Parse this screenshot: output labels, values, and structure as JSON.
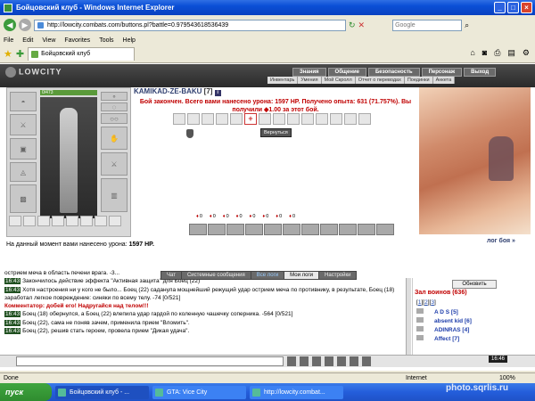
{
  "window": {
    "title": "Бойцовский клуб - Windows Internet Explorer"
  },
  "address": {
    "url": "http://lowcity.combats.com/buttons.pl?battle=0.979543618536439",
    "search_placeholder": "Google"
  },
  "menu": [
    "File",
    "Edit",
    "View",
    "Favorites",
    "Tools",
    "Help"
  ],
  "tab": {
    "label": "Бойцовский клуб"
  },
  "game": {
    "logo": "LOWCITY",
    "topnav": [
      "Знания",
      "Общение",
      "Безопасность",
      "Персонаж",
      "Выход"
    ],
    "subnav": [
      "Инвентарь",
      "Умения",
      "Мой Скролл",
      "Отчет о переводах",
      "Поединки",
      "Анкета"
    ],
    "hp": "0/473",
    "nick": "KAMIKAD-ZE-BAKU",
    "level": "[7]",
    "end_msg": "Бой закончен. Всего вами нанесено урона: 1597 HP. Получено опыта: 631 (71.757%). Вы получили ◆1.00 за этот бой.",
    "back_button": "Вернуться",
    "stats": [
      "0",
      "0",
      "0",
      "0",
      "0",
      "0",
      "0",
      "0"
    ],
    "damage_prefix": "На данный момент вами нанесено урона:",
    "damage_value": "1597 HP.",
    "log_link": "лог боя »"
  },
  "chat": {
    "tabs": [
      "Чат",
      "Системные сообщения",
      "Все логи",
      "Мои логи",
      "Настройки"
    ],
    "lines": [
      {
        "pre": "",
        "text": "острием меча в область печени врага. -3..."
      },
      {
        "time": "16:43",
        "text": "Закончилось действие эффекта \"Активная защита\" для Боец (22)"
      },
      {
        "time": "16:43",
        "text": "Хотя настроения ни у кого не было... Боец (22) саданула мощнейший режущий удар острием меча по противнику, в результате, Боец (18) заработал легкое повреждение: синяки по всему телу. -74 [0/521]"
      },
      {
        "pre": "Комментатор:",
        "text": "добей его! Надругайся над телом!!!"
      },
      {
        "time": "16:43",
        "text": "Боец (18) обернулся, а Боец (22) влепила удар гардой по коленную чашечку соперника. -564 [0/521]"
      },
      {
        "time": "16:43",
        "text": "Боец (22), сама не поняв зачем, применила прием \"Вломить\"."
      },
      {
        "time": "16:43",
        "text": "Боец (22), решив стать героем, провела прием \"Дикая удача\"."
      }
    ]
  },
  "room": {
    "refresh": "Обновить",
    "title": "Зал воинов (636)",
    "pages": [
      "1",
      "2",
      "3"
    ],
    "players": [
      "A D S [5]",
      "absent kid [6]",
      "ADINRAS [4]",
      "Affect [7]"
    ]
  },
  "clock": "16:46",
  "status": {
    "left": "Done",
    "zone": "Internet",
    "zoom": "100%"
  },
  "taskbar": {
    "start": "пуск",
    "tasks": [
      "Бойцовский клуб - ...",
      "GTA: Vice City",
      "http://lowcity.combat..."
    ]
  },
  "watermark": "photo.sqrlis.ru"
}
